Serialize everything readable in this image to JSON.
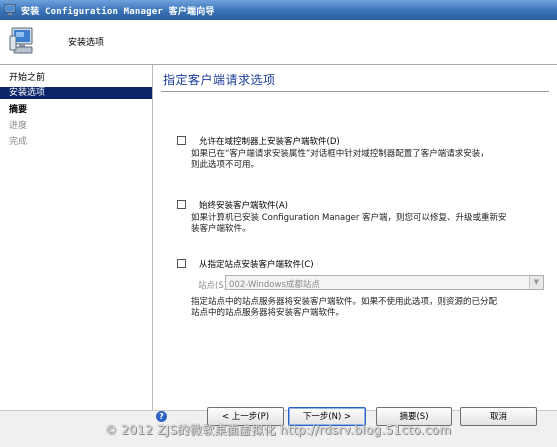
{
  "window": {
    "title": "安装 Configuration Manager 客户端向导"
  },
  "banner": {
    "title": "安装选项"
  },
  "nav": {
    "items": [
      {
        "label": "开始之前"
      },
      {
        "label": "安装选项"
      },
      {
        "label": "摘要"
      },
      {
        "label": "进度"
      },
      {
        "label": "完成"
      }
    ]
  },
  "main": {
    "title": "指定客户端请求选项",
    "options": [
      {
        "label": "允许在域控制器上安装客户端软件(D)",
        "desc_line1": "如果已在“客户端请求安装属性”对话框中针对域控制器配置了客户端请求安装，",
        "desc_line2": "则此选项不可用。",
        "checked": false
      },
      {
        "label": "始终安装客户端软件(A)",
        "desc_line1": "如果计算机已安装 Configuration Manager 客户端，则您可以修复、升级或重新安",
        "desc_line2": "装客户端软件。",
        "checked": false
      },
      {
        "label": "从指定站点安装客户端软件(C)",
        "site_label": "站点(S):",
        "site_value": "002-Windows成都站点",
        "desc_line1": "指定站点中的站点服务器将安装客户端软件。如果不使用此选项，则资源的已分配",
        "desc_line2": "站点中的站点服务器将安装客户端软件。",
        "checked": false
      }
    ]
  },
  "footer": {
    "help": "?",
    "prev": "< 上一步(P)",
    "next": "下一步(N) >",
    "summary": "摘要(S)",
    "cancel": "取消"
  },
  "watermark": "© 2012 ZJS的微软桌面虚拟化 http://rdsrv.blog.51cto.com",
  "colors": {
    "titlebar": "#3a73b8",
    "nav_active": "#0a246a",
    "page_title": "#1a3c9a"
  },
  "icons": {
    "titlebar": "computer-icon",
    "banner": "computer-setup-icon",
    "help": "help-icon"
  }
}
